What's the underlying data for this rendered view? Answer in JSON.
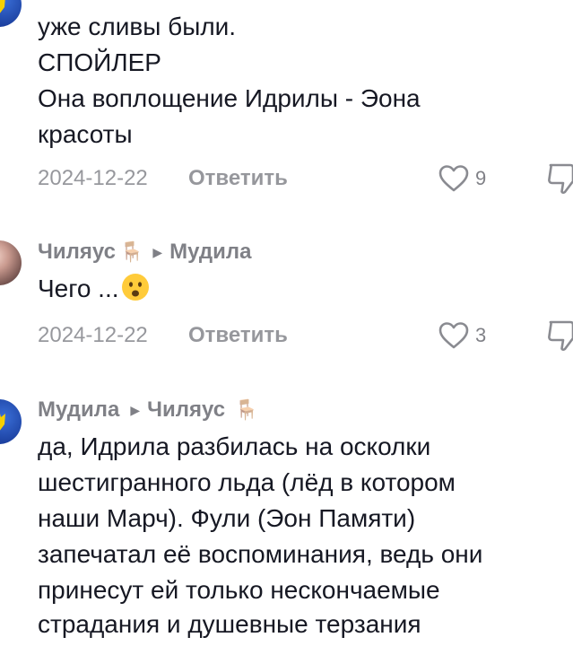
{
  "comment1": {
    "lines": [
      "уже сливы были.",
      "СПОЙЛЕР",
      "Она воплощение Идрилы - Эона",
      "красоты"
    ],
    "date": "2024-12-22",
    "reply_label": "Ответить",
    "likes": "9"
  },
  "comment2": {
    "author": "Чиляус",
    "author_emoji": "🪑",
    "reply_to": "Мудила",
    "text": "Чего ...",
    "date": "2024-12-22",
    "reply_label": "Ответить",
    "likes": "3"
  },
  "comment3": {
    "author": "Мудила",
    "reply_to": "Чиляус",
    "reply_to_emoji": "🪑",
    "lines": [
      "да, Идрила разбилась на осколки",
      "шестигранного льда (лёд в котором",
      "наши Марч). Фули (Эон Памяти)",
      "запечатал её воспоминания, ведь они",
      "принесут ей только нескончаемые",
      "страдания и душевные терзания"
    ]
  },
  "colors": {
    "text": "#161823",
    "muted": "#8a8b91",
    "avatar_blue": "#1b3f9e",
    "emblem_yellow": "#f5d000"
  },
  "icons": [
    "heart-outline-icon",
    "dislike-icon",
    "chair-emoji",
    "frowning-face-emoji",
    "caret-right-icon"
  ]
}
